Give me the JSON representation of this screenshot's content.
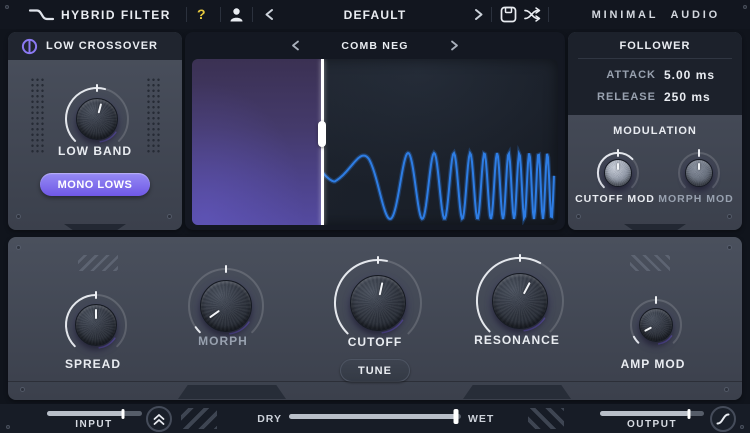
{
  "titlebar": {
    "title": "HYBRID FILTER",
    "help": "?",
    "preset": "DEFAULT",
    "brand": "MINIMAL AUDIO"
  },
  "left_panel": {
    "header": "LOW CROSSOVER",
    "knob": {
      "label": "LOW BAND",
      "angle": 15,
      "arc_end": 15,
      "face": "dark"
    },
    "mono_button": "MONO LOWS"
  },
  "display": {
    "selector": "COMB NEG"
  },
  "follower": {
    "header": "FOLLOWER",
    "rows": [
      {
        "label": "ATTACK",
        "value": "5.00 ms"
      },
      {
        "label": "RELEASE",
        "value": "250 ms"
      }
    ],
    "modulation_header": "MODULATION",
    "knobs": [
      {
        "label": "CUTOFF MOD",
        "angle": 0,
        "arc_end": 46,
        "face": "bright"
      },
      {
        "label": "MORPH MOD",
        "angle": 0,
        "arc_end": -135,
        "face": "dim"
      }
    ]
  },
  "main": {
    "knobs": [
      {
        "label": "SPREAD",
        "angle": 0,
        "arc_end": 0,
        "face": "dark"
      },
      {
        "label": "MORPH",
        "angle": -125,
        "arc_end": -125,
        "face": "dark"
      },
      {
        "label": "CUTOFF",
        "angle": 12,
        "arc_end": 12,
        "face": "dark"
      },
      {
        "label": "RESONANCE",
        "angle": 28,
        "arc_end": 28,
        "face": "dark"
      },
      {
        "label": "AMP MOD",
        "angle": -118,
        "arc_end": -118,
        "face": "dark"
      }
    ],
    "tune_button": "TUNE"
  },
  "bottom_bar": {
    "input_label": "INPUT",
    "dry_label": "DRY",
    "wet_label": "WET",
    "output_label": "OUTPUT",
    "input_percent": 80,
    "mix_percent": 97,
    "output_percent": 86
  },
  "colors": {
    "accent_purple": "#7a63ee",
    "wave_blue": "#2e7de4",
    "help_yellow": "#e7c93e"
  }
}
